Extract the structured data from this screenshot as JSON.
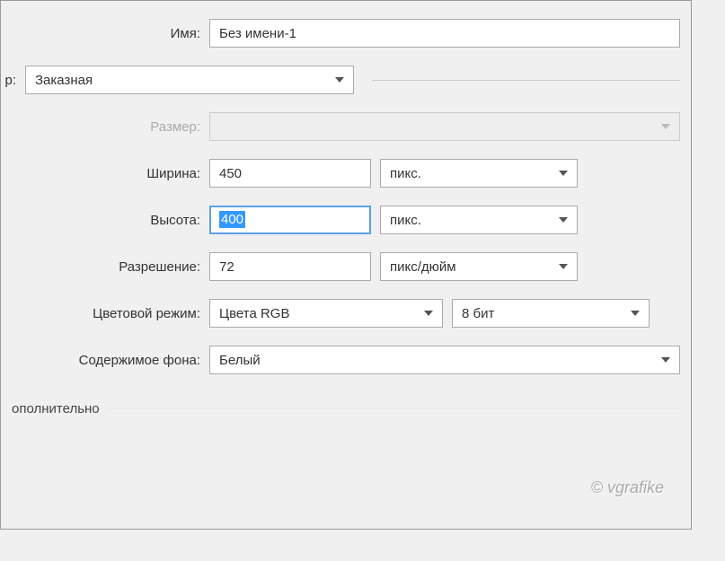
{
  "labels": {
    "name": "Имя:",
    "preset_prefix": "р:",
    "size": "Размер:",
    "width": "Ширина:",
    "height": "Высота:",
    "resolution": "Разрешение:",
    "color_mode": "Цветовой режим:",
    "background": "Содержимое фона:",
    "advanced": "ополнительно"
  },
  "values": {
    "name": "Без имени-1",
    "preset": "Заказная",
    "width": "450",
    "height": "400",
    "resolution": "72",
    "color_mode": "Цвета RGB",
    "bit_depth": "8 бит",
    "background": "Белый"
  },
  "units": {
    "width": "пикс.",
    "height": "пикс.",
    "resolution": "пикс/дюйм"
  },
  "watermark": "© vgrafike"
}
